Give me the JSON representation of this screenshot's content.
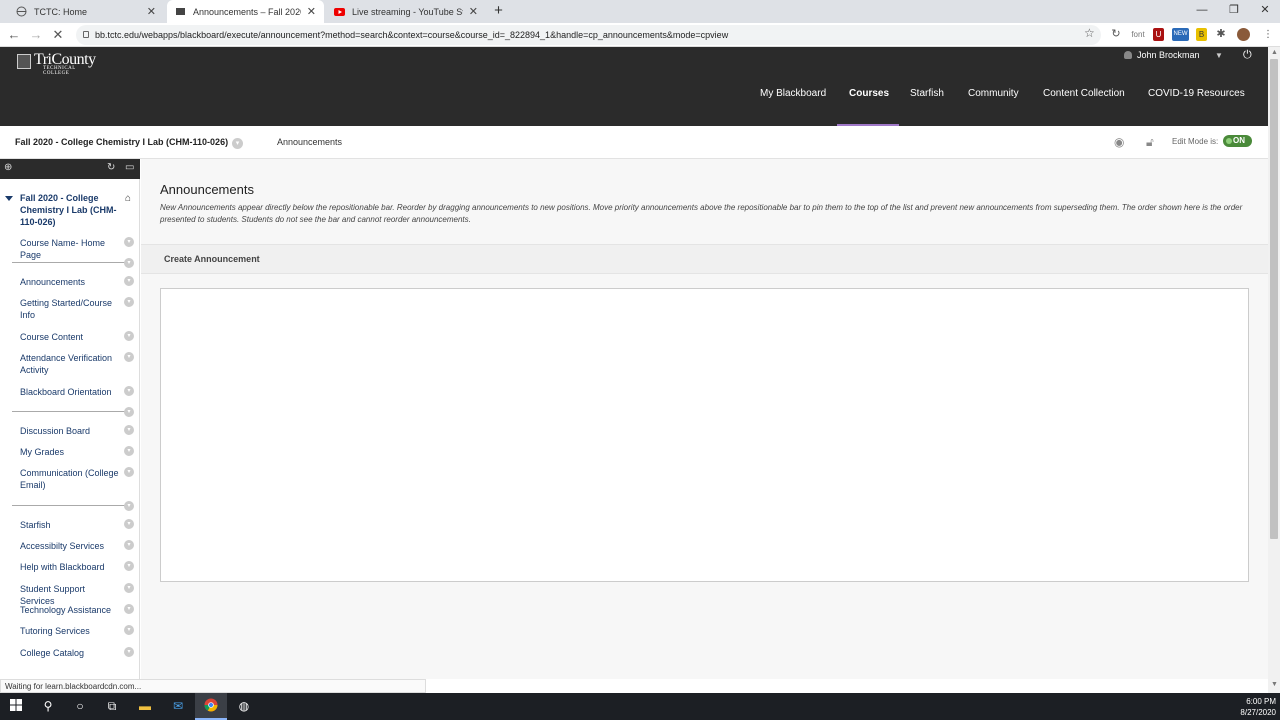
{
  "browser": {
    "tabs": [
      {
        "title": "TCTC: Home",
        "favicon": "globe-icon",
        "active": false
      },
      {
        "title": "Announcements – Fall 2020 - Co",
        "favicon": "blackboard-icon",
        "active": true
      },
      {
        "title": "Live streaming - YouTube Studio",
        "favicon": "youtube-icon",
        "active": false
      }
    ],
    "url": "bb.tctc.edu/webapps/blackboard/execute/announcement?method=search&context=course&course_id=_822894_1&handle=cp_announcements&mode=cpview",
    "ext_font_label": "font",
    "ext_new_label": "NEW"
  },
  "header": {
    "logo_big": "TriCounty",
    "logo_small": "TECHNICAL COLLEGE",
    "user_name": "John Brockman",
    "nav": [
      "My Blackboard",
      "Courses",
      "Starfish",
      "Community",
      "Content Collection",
      "COVID-19 Resources"
    ],
    "active_nav": "Courses",
    "accent": "#a078c8"
  },
  "coursebar": {
    "course_title": "Fall 2020 - College Chemistry I Lab (CHM-110-026)",
    "breadcrumb": "Announcements",
    "edit_mode_label": "Edit Mode is:",
    "edit_mode_value": "ON"
  },
  "sidebar": {
    "course_title": "Fall 2020 - College Chemistry I Lab (CHM-110-026)",
    "items": [
      "Course Name- Home Page",
      "Announcements",
      "Getting Started/Course Info",
      "Course Content",
      "Attendance Verification Activity",
      "Blackboard Orientation",
      "Discussion Board",
      "My Grades",
      "Communication (College Email)",
      "Starfish",
      "Accessibilty Services",
      "Help with Blackboard",
      "Student Support Services",
      "Technology Assistance",
      "Tutoring Services",
      "College Catalog"
    ]
  },
  "main": {
    "title": "Announcements",
    "description": "New Announcements appear directly below the repositionable bar. Reorder by dragging announcements to new positions. Move priority announcements above the repositionable bar to pin them to the top of the list and prevent new announcements from superseding them. The order shown here is the order presented to students. Students do not see the bar and cannot reorder announcements.",
    "create_button": "Create Announcement"
  },
  "status_text": "Waiting for learn.blackboardcdn.com...",
  "taskbar": {
    "time": "6:00 PM",
    "date": "8/27/2020"
  }
}
